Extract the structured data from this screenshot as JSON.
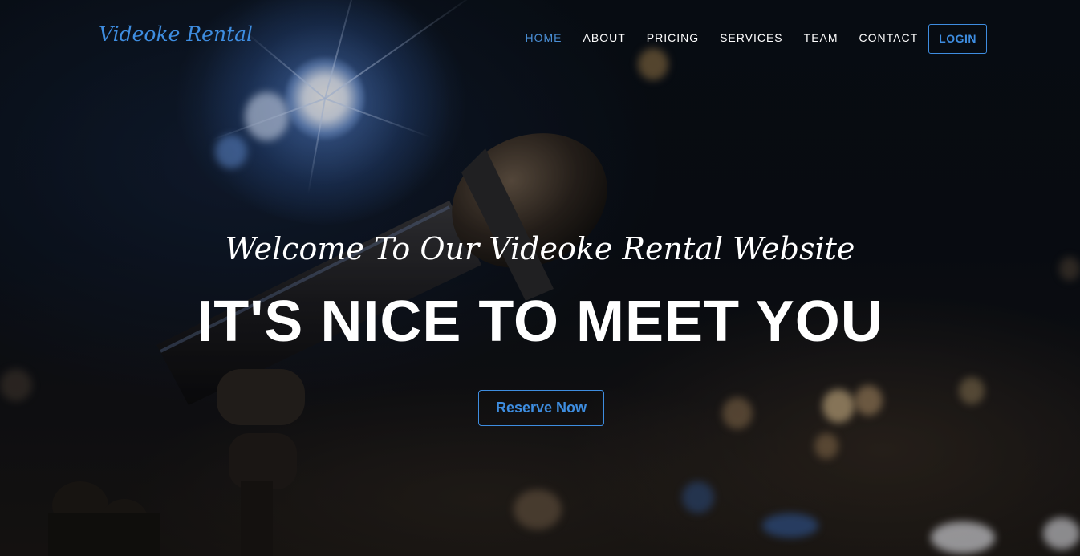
{
  "brand": {
    "name": "Videoke Rental"
  },
  "nav": {
    "items": [
      {
        "label": "HOME",
        "active": true
      },
      {
        "label": "ABOUT",
        "active": false
      },
      {
        "label": "PRICING",
        "active": false
      },
      {
        "label": "SERVICES",
        "active": false
      },
      {
        "label": "TEAM",
        "active": false
      },
      {
        "label": "CONTACT",
        "active": false
      }
    ],
    "login_label": "LOGIN"
  },
  "hero": {
    "subtitle": "Welcome To Our Videoke Rental Website",
    "title": "IT'S NICE TO MEET YOU",
    "cta_label": "Reserve Now",
    "background_image": "concert-microphone-photo"
  },
  "colors": {
    "accent": "#3e8de0",
    "nav_text": "#ffffff",
    "hero_text": "#ffffff"
  }
}
